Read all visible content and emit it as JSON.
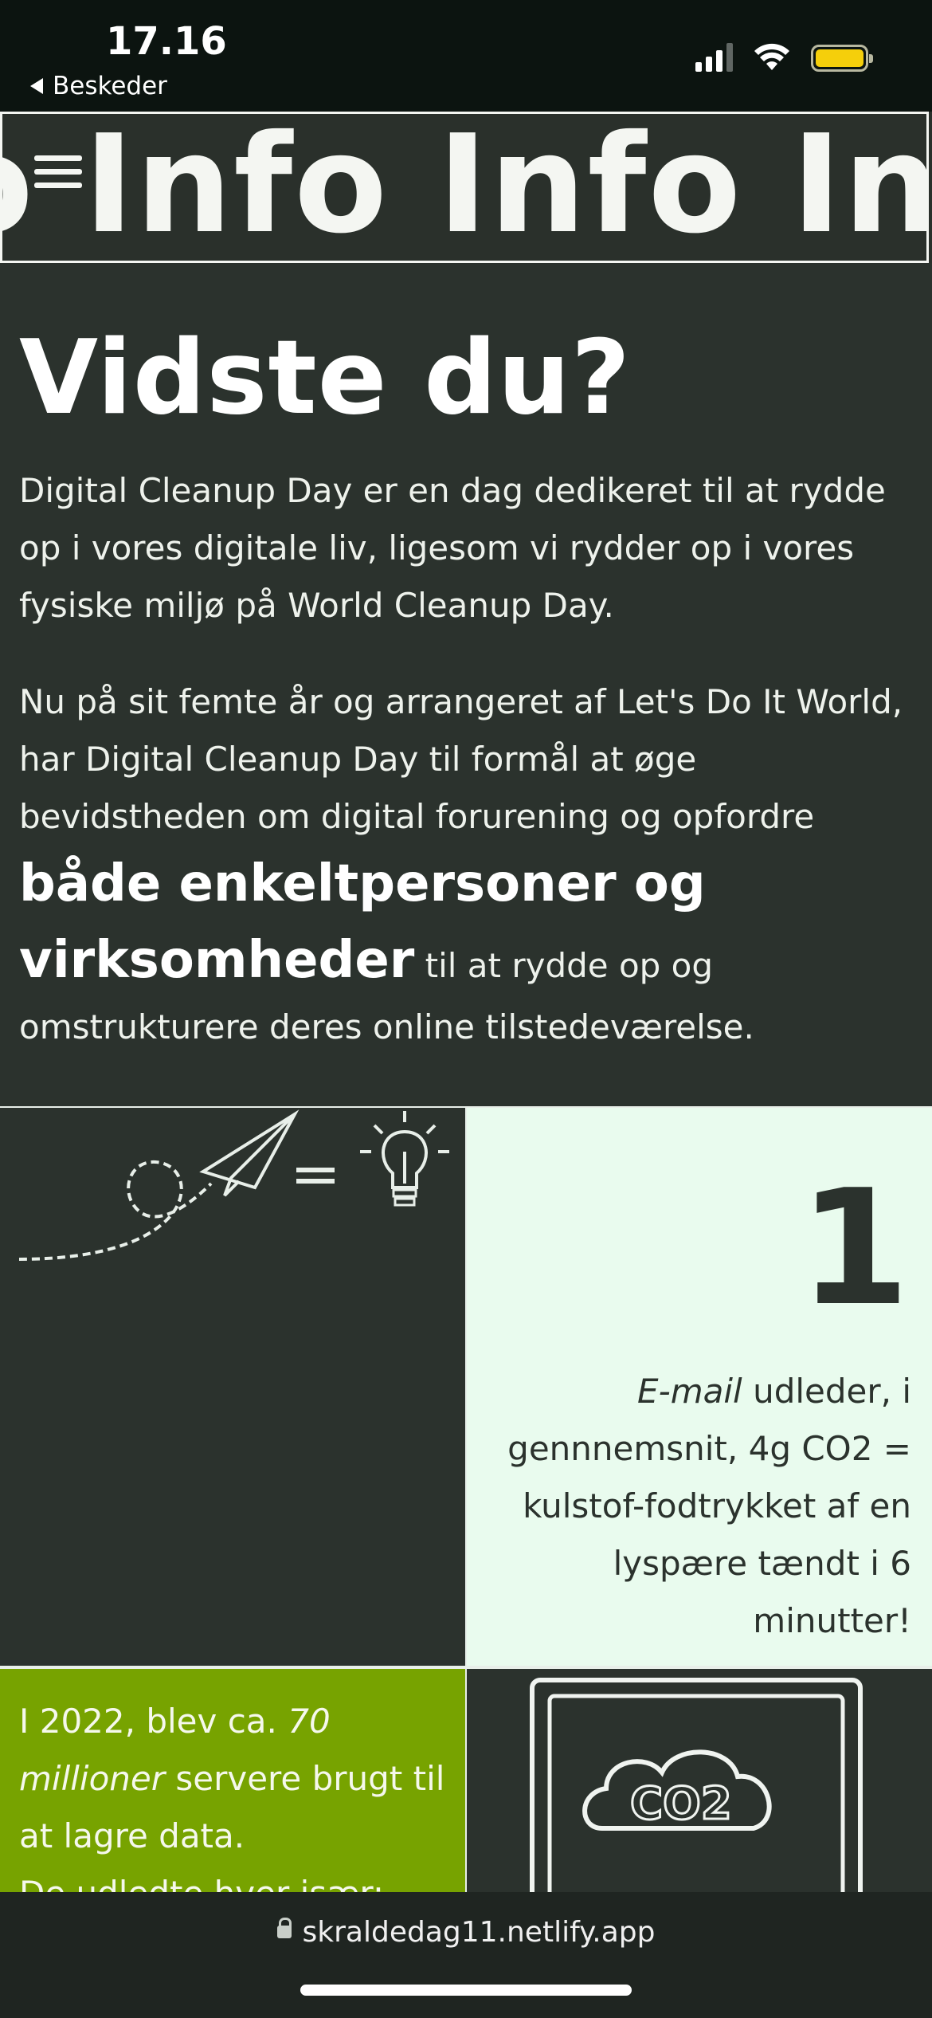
{
  "status_bar": {
    "time": "17.16",
    "back_label": "Beskeder"
  },
  "marquee": {
    "text": "o Info Info Info Info"
  },
  "intro": {
    "heading": "Vidste du?",
    "paragraph1": "Digital Cleanup Day er en dag dedikeret til at rydde op i vores digitale liv, ligesom vi rydder op i vores fysiske miljø på World Cleanup Day.",
    "paragraph2_start": "Nu på sit femte år og arrangeret af Let's Do It World, har Digital Cleanup Day til formål at øge bevidstheden om digital forurening og opfordre ",
    "paragraph2_emphasis": "både enkeltpersoner og virksomheder",
    "paragraph2_end": " til at rydde op og omstrukturere deres online tilstedeværelse."
  },
  "fact1": {
    "number": "1",
    "text_emph": "E-mail",
    "text_rest": " udleder, i gennnemsnit, 4g CO2 = kulstof-fodtrykket af en lyspære tændt i 6 minutter!"
  },
  "fact2": {
    "text_a": "I 2022, blev ca. ",
    "text_emph": "70 millioner",
    "text_b": " servere brugt til at lagre data.",
    "text_c": "De udledte hver især:"
  },
  "co2_icon": {
    "label": "CO2"
  },
  "browser": {
    "url": "skraldedag11.netlify.app"
  },
  "colors": {
    "dark_green": "#2b322d",
    "mint": "#e9fbee",
    "lime": "#77a300"
  }
}
